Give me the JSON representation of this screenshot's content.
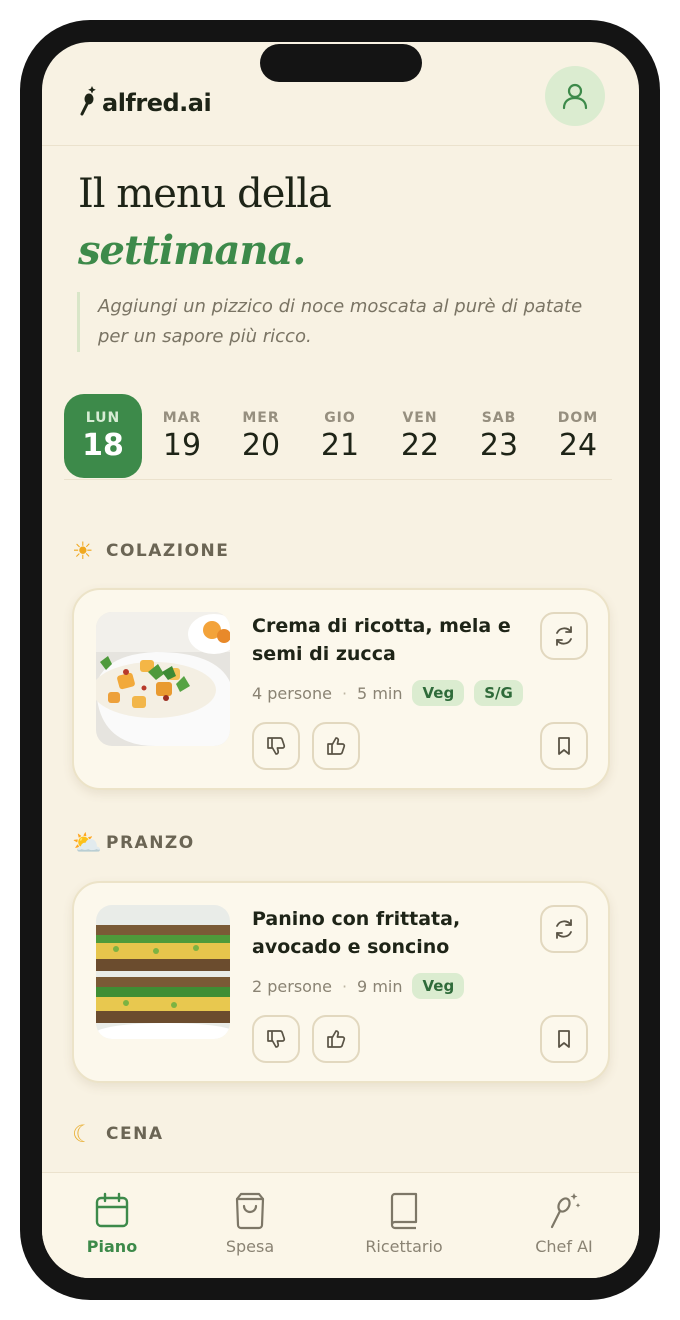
{
  "app": {
    "name": "alfred.ai"
  },
  "header": {
    "avatar_icon": "user-icon"
  },
  "hero": {
    "title": "Il menu della",
    "accent": "settimana.",
    "tip": "Aggiungi un pizzico di noce moscata al purè di patate per un sapore più ricco."
  },
  "days": [
    {
      "name": "LUN",
      "num": "18",
      "active": true
    },
    {
      "name": "MAR",
      "num": "19"
    },
    {
      "name": "MER",
      "num": "20"
    },
    {
      "name": "GIO",
      "num": "21"
    },
    {
      "name": "VEN",
      "num": "22"
    },
    {
      "name": "SAB",
      "num": "23"
    },
    {
      "name": "DOM",
      "num": "24"
    }
  ],
  "meals": [
    {
      "label": "COLAZIONE",
      "emoji": "☀",
      "recipe": {
        "title": "Crema di ricotta, mela e semi di zucca",
        "persons": "4 persone",
        "time": "5 min",
        "tags": [
          "Veg",
          "S/G"
        ]
      }
    },
    {
      "label": "PRANZO",
      "emoji": "⛅",
      "recipe": {
        "title": "Panino con frittata, avocado e soncino",
        "persons": "2 persone",
        "time": "9 min",
        "tags": [
          "Veg"
        ]
      }
    },
    {
      "label": "CENA",
      "emoji": "☾"
    }
  ],
  "nav": [
    {
      "label": "Piano",
      "icon": "calendar-icon",
      "active": true
    },
    {
      "label": "Spesa",
      "icon": "shopping-bag-icon"
    },
    {
      "label": "Ricettario",
      "icon": "book-icon"
    },
    {
      "label": "Chef AI",
      "icon": "sparkle-spoon-icon"
    }
  ],
  "colors": {
    "accent": "#3d8a4a",
    "background": "#f8f2e3",
    "tag_bg": "#dbecd0"
  }
}
